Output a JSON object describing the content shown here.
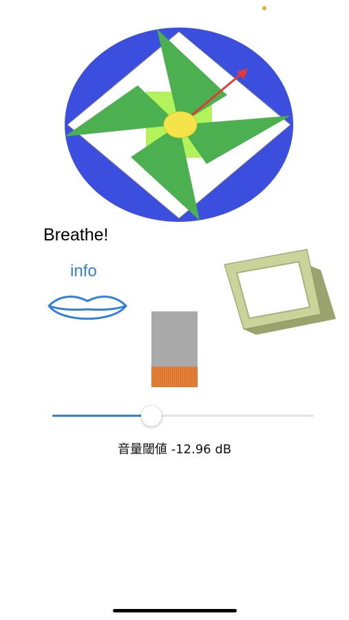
{
  "app": {
    "breathe_label": "Breathe!",
    "info_label": "info"
  },
  "slider": {
    "value_fraction": 0.38,
    "threshold_label": "音量閾値 -12.96 dB"
  },
  "meter": {
    "level_fraction": 0.27
  },
  "icons": {
    "pinwheel": "pinwheel-icon",
    "lips": "lips-icon",
    "frame": "square-frame-icon",
    "arrow": "arrow-icon",
    "status": "status-dot-icon"
  },
  "colors": {
    "accent_blue": "#2f7fe0",
    "ring_blue": "#3b4ede",
    "blade_green": "#4caf50",
    "center_green": "#b2f25a",
    "hub_yellow": "#f4e34a",
    "arrow_red": "#e53935",
    "meter_gray": "#a9a9a9",
    "meter_orange": "#e8853a",
    "frame_green": "#c9d39a",
    "status_orange": "#f5a623"
  }
}
